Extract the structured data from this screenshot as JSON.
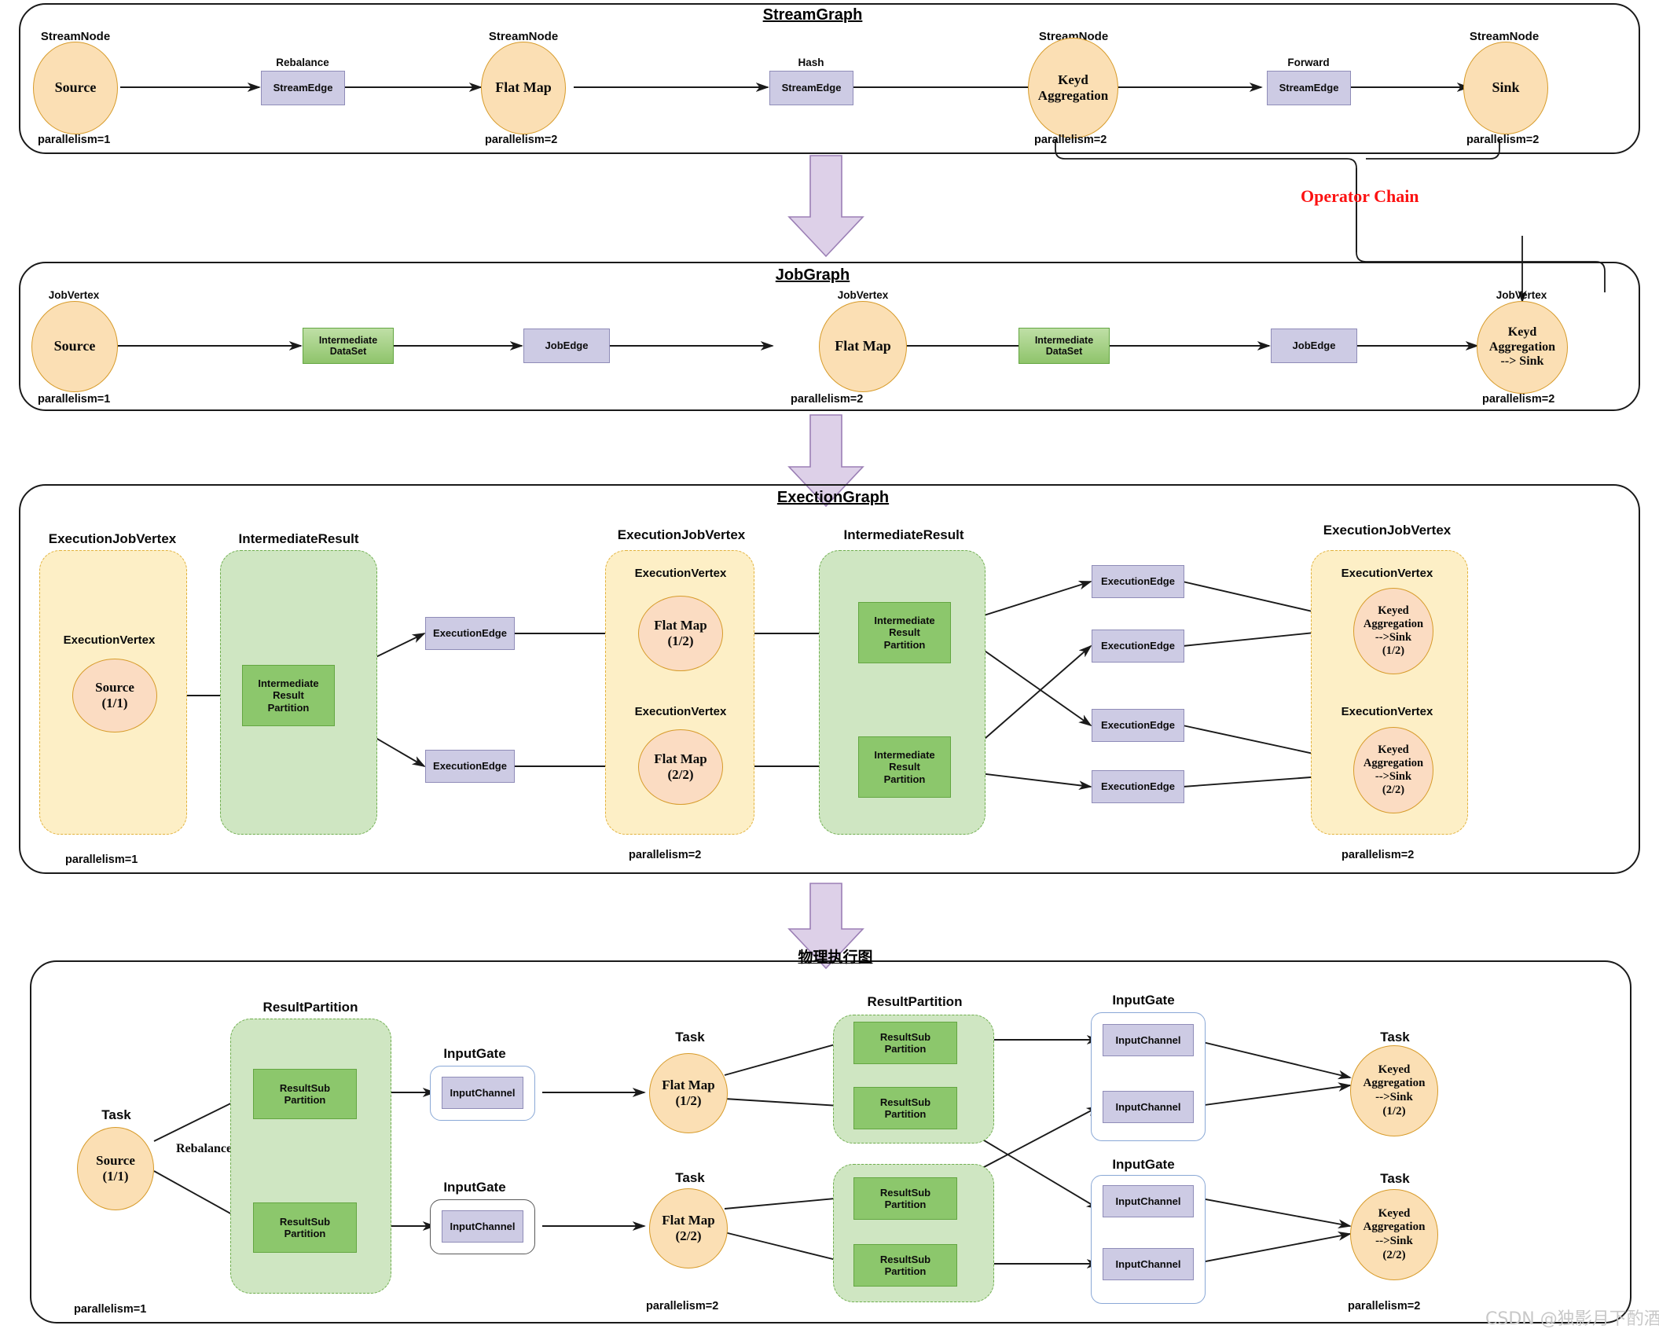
{
  "sections": {
    "stream_graph": {
      "title": "StreamGraph",
      "node_caption": "StreamNode",
      "nodes": [
        {
          "label": "Source",
          "parallelism": "parallelism=1"
        },
        {
          "label": "Flat Map",
          "parallelism": "parallelism=2"
        },
        {
          "label": "Keyd\nAggregation",
          "parallelism": "parallelism=2"
        },
        {
          "label": "Sink",
          "parallelism": "parallelism=2"
        }
      ],
      "edges": [
        {
          "caption": "Rebalance",
          "label": "StreamEdge"
        },
        {
          "caption": "Hash",
          "label": "StreamEdge"
        },
        {
          "caption": "Forward",
          "label": "StreamEdge"
        }
      ],
      "operator_chain_label": "Operator Chain"
    },
    "job_graph": {
      "title": "JobGraph",
      "node_caption": "JobVertex",
      "nodes": [
        {
          "label": "Source",
          "parallelism": "parallelism=1"
        },
        {
          "label": "Flat Map",
          "parallelism": "parallelism=2"
        },
        {
          "label": "Keyd\nAggregation\n--> Sink",
          "parallelism": "parallelism=2"
        }
      ],
      "dataset_label": "Intermediate\nDataSet",
      "jobedge_label": "JobEdge"
    },
    "execution_graph": {
      "title": "ExectionGraph",
      "captions": {
        "job_vertex": "ExecutionJobVertex",
        "intermediate_result": "IntermediateResult",
        "vertex": "ExecutionVertex"
      },
      "vertices": [
        {
          "label": "Source\n(1/1)"
        },
        {
          "label": "Flat Map\n(1/2)"
        },
        {
          "label": "Flat Map\n(2/2)"
        },
        {
          "label": "Keyed\nAggregation\n-->Sink\n(1/2)"
        },
        {
          "label": "Keyed\nAggregation\n-->Sink\n(2/2)"
        }
      ],
      "partition_label": "Intermediate\nResult\nPartition",
      "execution_edge_label": "ExecutionEdge",
      "parallelism": [
        "parallelism=1",
        "parallelism=2",
        "parallelism=2"
      ]
    },
    "physical_graph": {
      "title": "物理执行图",
      "captions": {
        "task": "Task",
        "result_partition": "ResultPartition",
        "input_gate": "InputGate"
      },
      "tasks": [
        {
          "label": "Source\n(1/1)"
        },
        {
          "label": "Flat Map\n(1/2)"
        },
        {
          "label": "Flat Map\n(2/2)"
        },
        {
          "label": "Keyed\nAggregation\n-->Sink\n(1/2)"
        },
        {
          "label": "Keyed\nAggregation\n-->Sink\n(2/2)"
        }
      ],
      "sub_partition_label": "ResultSub\nPartition",
      "input_channel_label": "InputChannel",
      "rebalance_label": "Rebalance",
      "parallelism": [
        "parallelism=1",
        "parallelism=2",
        "parallelism=2"
      ]
    }
  },
  "watermark": "CSDN @独影月下酌酒",
  "colors": {
    "node_fill": "#fbdfb4",
    "node_stroke": "#d79b2a",
    "edge_fill": "#cdcbe4",
    "edge_stroke": "#8f8cb8",
    "green_fill": "#8fc46b",
    "green_stroke": "#63a641",
    "group_yellow": "#fdefc6",
    "group_green": "#cfe6c2",
    "accent_red": "#fc1111",
    "arrow_purple": "#ddd0e8"
  }
}
